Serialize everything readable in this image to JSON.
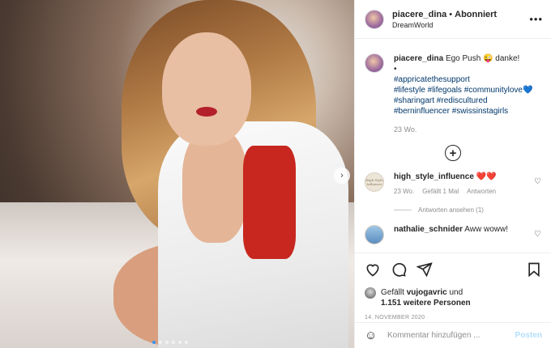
{
  "header": {
    "username": "piacere_dina",
    "separator": "•",
    "follow_status": "Abonniert",
    "location": "DreamWorld",
    "more_icon": "more-horizontal-icon"
  },
  "caption": {
    "username": "piacere_dina",
    "text": "Ego Push 😜 danke!",
    "bullet": "•",
    "hashtags": [
      "#appricatethesupport",
      "#lifestyle #lifegoals #communitylove💙",
      "#sharingart #rediscultured",
      "#berninfluencer #swissinstagirls"
    ],
    "age": "23 Wo."
  },
  "load_more_icon": "plus-circle-icon",
  "comments": [
    {
      "username": "high_style_influence",
      "text": "❤️❤️",
      "avatar_text": "High Style Influence",
      "age": "23 Wo.",
      "likes": "Gefällt 1 Mal",
      "reply": "Antworten",
      "view_replies": "Antworten ansehen (1)"
    },
    {
      "username": "nathalie_schnider",
      "text": "Aww woww!"
    }
  ],
  "actions": {
    "like_icon": "heart-icon",
    "comment_icon": "comment-icon",
    "share_icon": "paper-plane-icon",
    "save_icon": "bookmark-icon"
  },
  "likes": {
    "prefix": "Gefällt",
    "user": "vujogavric",
    "conj": "und",
    "others": "1.151 weitere Personen"
  },
  "date": "14. NOVEMBER 2020",
  "add_comment": {
    "placeholder": "Kommentar hinzufügen ...",
    "post_label": "Posten",
    "emoji_icon": "smiley-icon"
  },
  "carousel": {
    "slides": 6,
    "active": 1,
    "next_icon": "chevron-right-icon"
  },
  "colors": {
    "link": "#00376b",
    "muted": "#8e8e8e",
    "post_disabled": "#b2dffc",
    "active_dot": "#3897f0"
  }
}
